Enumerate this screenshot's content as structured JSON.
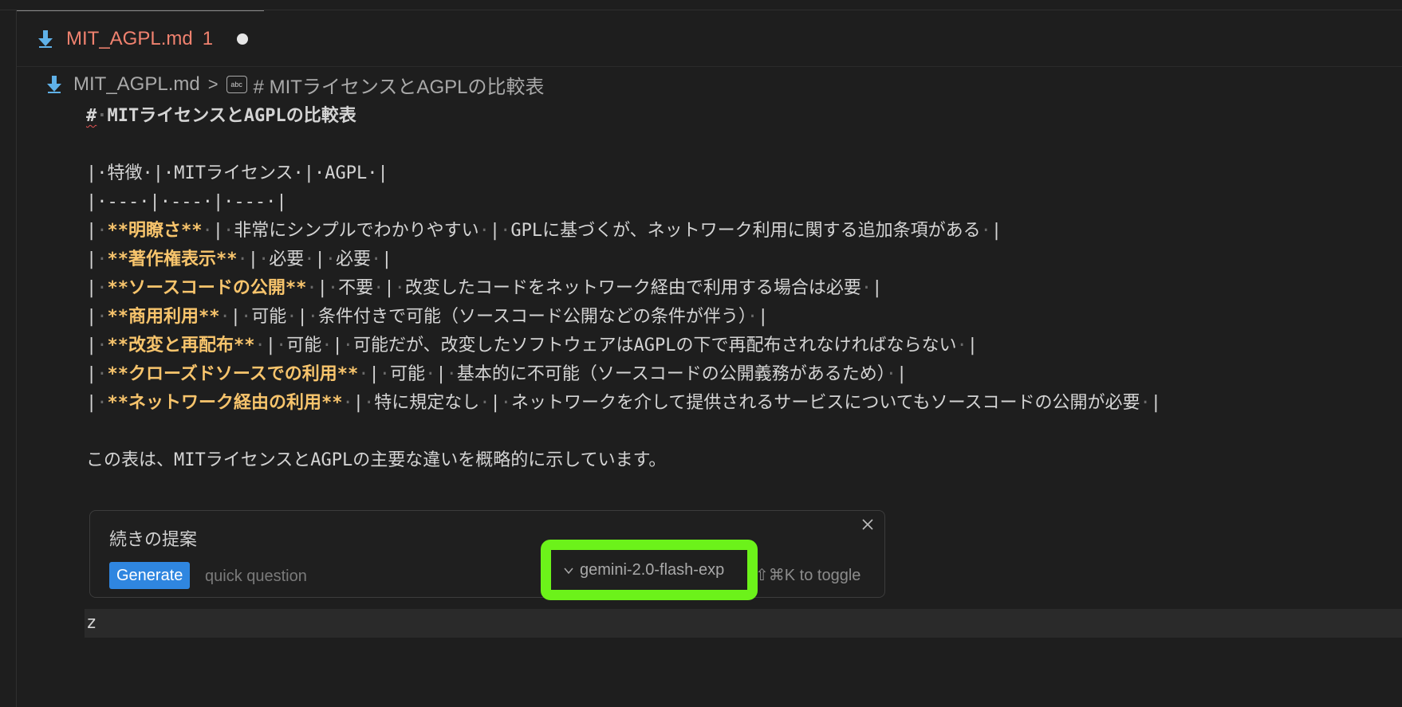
{
  "tab": {
    "filename": "MIT_AGPL.md",
    "problem_count": "1",
    "icon": "download-arrow-icon"
  },
  "breadcrumb": {
    "file": "MIT_AGPL.md",
    "separator": ">",
    "symbol_icon": "abc-icon",
    "symbol": "# MITライセンスとAGPLの比較表"
  },
  "editor": {
    "heading_hash": "#",
    "heading_text": "MITライセンスとAGPLの比較表",
    "table_header": "|·特徴·|·MITライセンス·|·AGPL·|",
    "table_separator": "|·---·|·---·|·---·|",
    "rows": [
      {
        "feature": "**明瞭さ**",
        "mit": "非常にシンプルでわかりやすい",
        "agpl": "GPLに基づくが、ネットワーク利用に関する追加条項がある"
      },
      {
        "feature": "**著作権表示**",
        "mit": "必要",
        "agpl": "必要"
      },
      {
        "feature": "**ソースコードの公開**",
        "mit": "不要",
        "agpl": "改変したコードをネットワーク経由で利用する場合は必要"
      },
      {
        "feature": "**商用利用**",
        "mit": "可能",
        "agpl": "条件付きで可能（ソースコード公開などの条件が伴う）"
      },
      {
        "feature": "**改変と再配布**",
        "mit": "可能",
        "agpl": "可能だが、改変したソフトウェアはAGPLの下で再配布されなければならない"
      },
      {
        "feature": "**クローズドソースでの利用**",
        "mit": "可能",
        "agpl": "基本的に不可能（ソースコードの公開義務があるため）"
      },
      {
        "feature": "**ネットワーク経由の利用**",
        "mit": "特に規定なし",
        "agpl": "ネットワークを介して提供されるサービスについてもソースコードの公開が必要"
      }
    ],
    "summary": "この表は、MITライセンスとAGPLの主要な違いを概略的に示しています。",
    "cursor_line_text": "z"
  },
  "panel": {
    "title": "続きの提案",
    "generate_label": "Generate",
    "input_placeholder": "quick question",
    "model_name": "gemini-2.0-flash-exp",
    "toggle_hint": "⇧⌘K to toggle",
    "highlight_color": "#6cf21a",
    "generate_color": "#2f86e0"
  }
}
